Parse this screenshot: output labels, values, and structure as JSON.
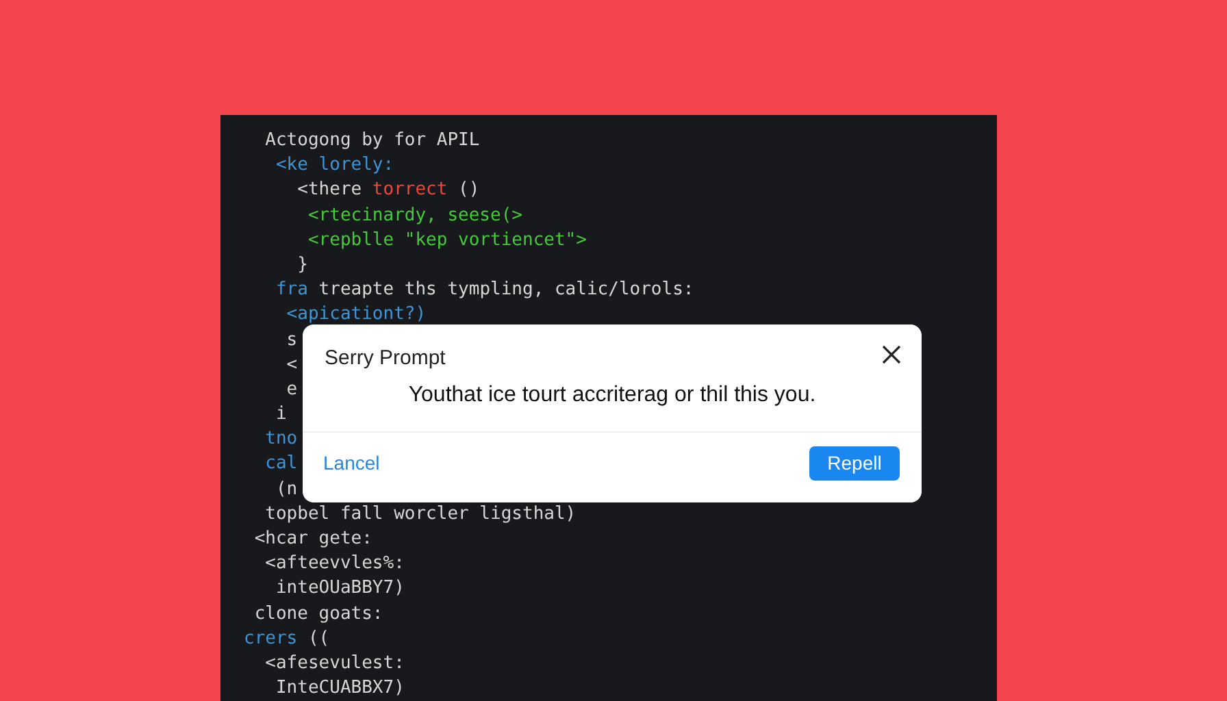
{
  "editor": {
    "lines": [
      [
        {
          "kind": "plain",
          "text": "  Actogong by for APIL"
        }
      ],
      [
        {
          "kind": "keyword",
          "text": "   <ke lorely:"
        }
      ],
      [
        {
          "kind": "plain",
          "text": "     <there "
        },
        {
          "kind": "error",
          "text": "torrect"
        },
        {
          "kind": "plain",
          "text": " ()"
        }
      ],
      [
        {
          "kind": "string",
          "text": "      <rtecinardy, seese(>"
        }
      ],
      [
        {
          "kind": "string",
          "text": "      <repblle \"kep vortiencet\">"
        }
      ],
      [
        {
          "kind": "plain",
          "text": "     }"
        }
      ],
      [
        {
          "kind": "keyword",
          "text": "   fra"
        },
        {
          "kind": "plain",
          "text": " treapte ths tympling, calic/lorols:"
        }
      ],
      [
        {
          "kind": "keyword",
          "text": "    <apicationt?)"
        }
      ],
      [
        {
          "kind": "plain",
          "text": "    s"
        }
      ],
      [
        {
          "kind": "plain",
          "text": "    <"
        }
      ],
      [
        {
          "kind": "plain",
          "text": "    e"
        }
      ],
      [
        {
          "kind": "plain",
          "text": "   i"
        }
      ],
      [
        {
          "kind": "keyword",
          "text": "  tno"
        }
      ],
      [
        {
          "kind": "keyword",
          "text": "  cal"
        }
      ],
      [
        {
          "kind": "plain",
          "text": "   (n"
        }
      ],
      [
        {
          "kind": "plain",
          "text": "  topbel fall worcler ligsthal)"
        }
      ],
      [
        {
          "kind": "plain",
          "text": " <hcar gete:"
        }
      ],
      [
        {
          "kind": "plain",
          "text": "  <afteevvles%:"
        }
      ],
      [
        {
          "kind": "plain",
          "text": "   inteOUaBBY7)"
        }
      ],
      [
        {
          "kind": "plain",
          "text": " clone goats:"
        }
      ],
      [
        {
          "kind": "keyword",
          "text": "crers"
        },
        {
          "kind": "plain",
          "text": " (("
        }
      ],
      [
        {
          "kind": "plain",
          "text": "  <afesevulest:"
        }
      ],
      [
        {
          "kind": "plain",
          "text": "   InteCUABBX7)"
        }
      ]
    ]
  },
  "dialog": {
    "title": "Serry Prompt",
    "message": "Youthat ice tourt accriterag or thil this you.",
    "cancel": "Lancel",
    "confirm": "Repell"
  }
}
